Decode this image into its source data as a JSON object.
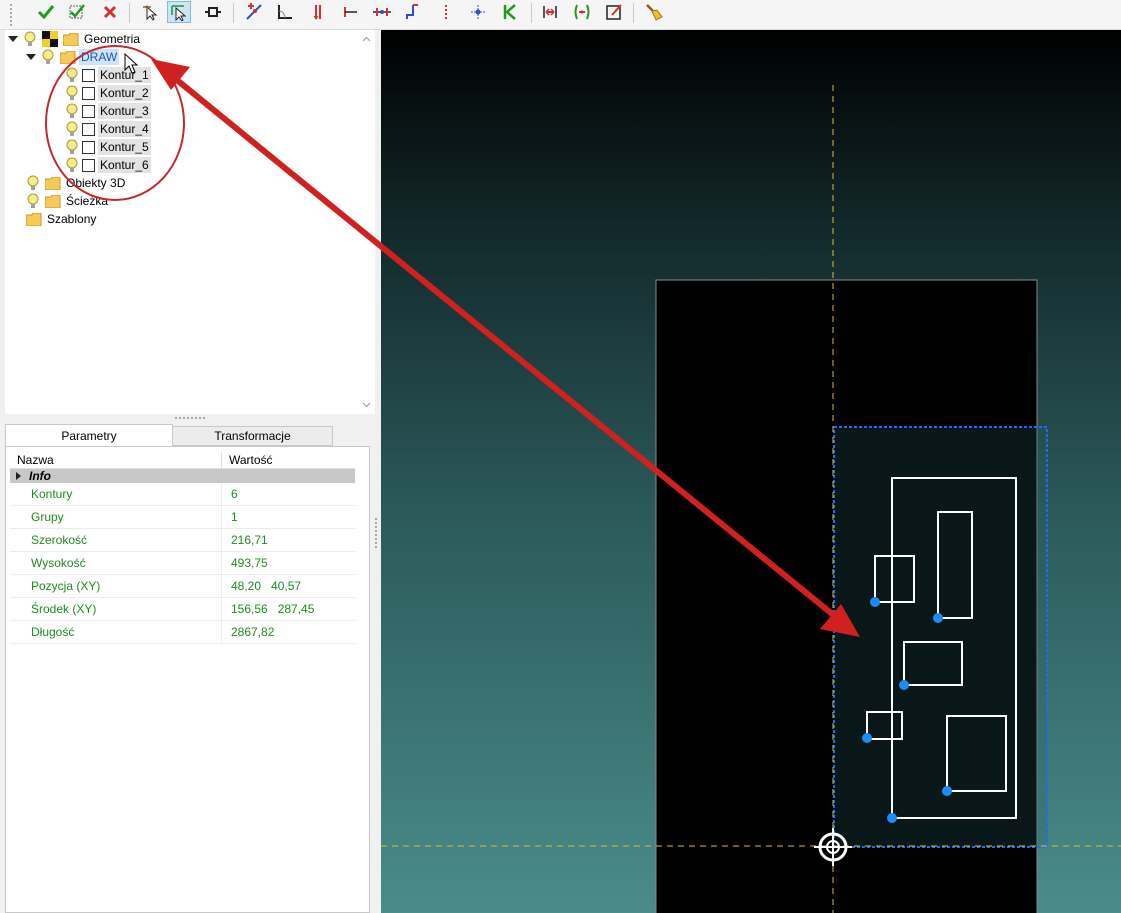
{
  "toolbar": {
    "buttons": [
      "accept-icon",
      "accept-all-icon",
      "reject-icon",
      "select-point-icon",
      "select-contour-icon",
      "link-icon",
      "add-point-icon",
      "corner-icon",
      "vertical-split-icon",
      "horizontal-split-icon",
      "distribute-icon",
      "align-icon",
      "dotted-line-icon",
      "center-point-icon",
      "bend-icon",
      "spread-horizontal-icon",
      "spread-center-icon",
      "edit-box-icon",
      "cleanup-brush-icon"
    ]
  },
  "tree": {
    "root": "Geometria",
    "draw": "DRAW",
    "contours": [
      "Kontur_1",
      "Kontur_2",
      "Kontur_3",
      "Kontur_4",
      "Kontur_5",
      "Kontur_6"
    ],
    "objects3d": "Obiekty 3D",
    "path": "Ścieżka",
    "templates": "Szablony"
  },
  "tabs": {
    "params": "Parametry",
    "transform": "Transformacje"
  },
  "props": {
    "col_name": "Nazwa",
    "col_value": "Wartość",
    "group": "Info",
    "rows": [
      {
        "name": "Kontury",
        "value": "6"
      },
      {
        "name": "Grupy",
        "value": "1"
      },
      {
        "name": "Szerokość",
        "value": "216,71"
      },
      {
        "name": "Wysokość",
        "value": "493,75"
      },
      {
        "name": "Pozycja (XY)",
        "value": "48,20   40,57"
      },
      {
        "name": "Środek (XY)",
        "value": "156,56   287,45"
      },
      {
        "name": "Długość",
        "value": "2867,82"
      }
    ]
  },
  "colors": {
    "accent": "#1e8c1e",
    "annotation": "#d02020",
    "point": "#1a8cff",
    "guide": "#d8c22a"
  }
}
